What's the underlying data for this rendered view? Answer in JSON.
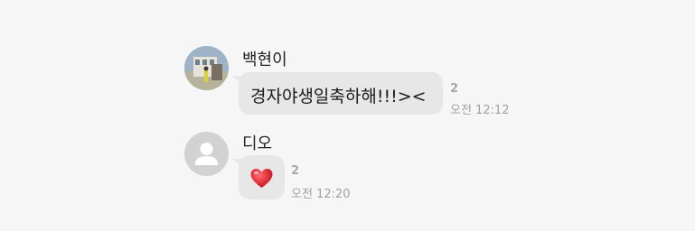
{
  "messages": [
    {
      "sender": "백현이",
      "avatar": "profile-photo",
      "text": "경자야생일축하해!!!><",
      "unread_count": "2",
      "time": "오전 12:12"
    },
    {
      "sender": "디오",
      "avatar": "default-person-icon",
      "content_icon": "red-heart-emoji",
      "unread_count": "2",
      "time": "오전 12:20"
    }
  ],
  "colors": {
    "background": "#f6f6f6",
    "bubble": "#e7e7e7",
    "meta_text": "#a0a0a0",
    "heart": "#e0303a"
  }
}
